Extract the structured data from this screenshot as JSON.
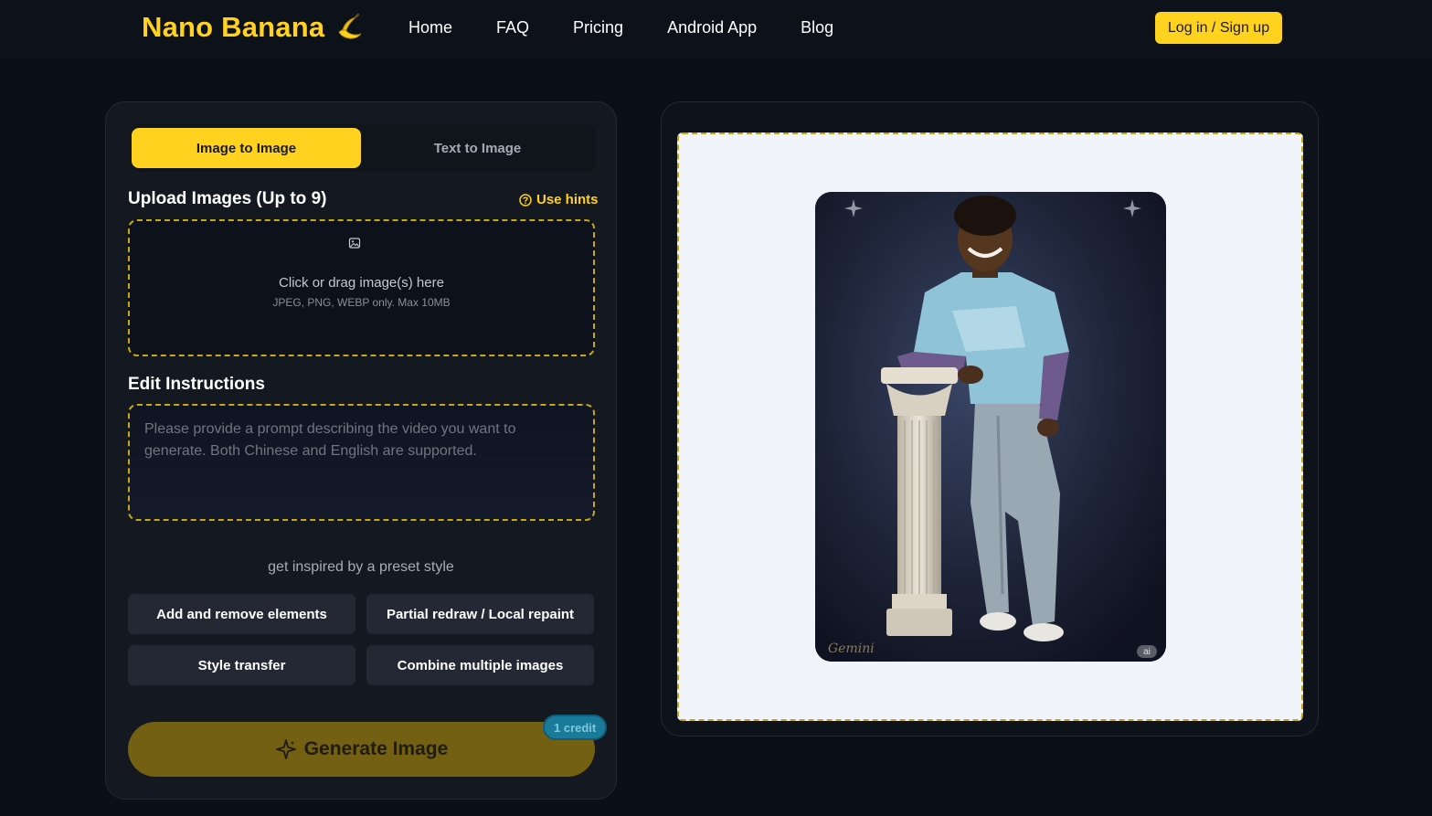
{
  "header": {
    "logo_text": "Nano Banana",
    "logo_icon": "banana-icon",
    "nav": [
      "Home",
      "FAQ",
      "Pricing",
      "Android App",
      "Blog"
    ],
    "login_label": "Log in / Sign up"
  },
  "left_panel": {
    "tabs": [
      "Image to Image",
      "Text to Image"
    ],
    "active_tab": "Image to Image",
    "upload_title": "Upload Images (Up to 9)",
    "hints_label": "Use hints",
    "upload_text": "Click or drag image(s) here",
    "upload_sub": "JPEG, PNG, WEBP only. Max 10MB",
    "edit_title": "Edit Instructions",
    "prompt_value": "",
    "prompt_placeholder": "Please provide a prompt describing the video you want to generate. Both Chinese and English are supported.",
    "inspire_text": "get inspired by a preset style",
    "presets": [
      "Add and remove elements",
      "Partial redraw / Local repaint",
      "Style transfer",
      "Combine multiple images"
    ],
    "generate_label": "Generate Image",
    "credit_label": "1 credit"
  },
  "preview": {
    "watermark": "Gemini",
    "ai_badge": "ai"
  },
  "colors": {
    "accent": "#ffd21f",
    "background": "#0b0f17",
    "panel": "#141921",
    "dashed_border": "#c9a812"
  }
}
